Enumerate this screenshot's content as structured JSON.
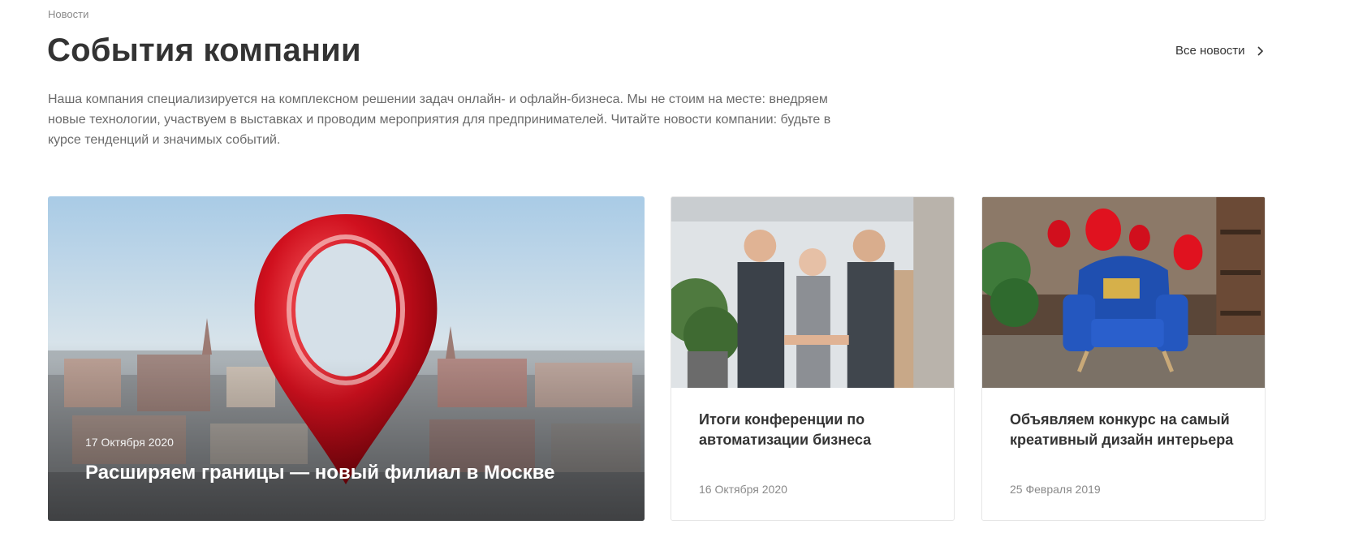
{
  "breadcrumb": "Новости",
  "page_title": "События компании",
  "all_news_label": "Все новости",
  "intro": "Наша компания специализируется на комплексном решении задач онлайн- и офлайн-бизнеса. Мы не стоим на месте: внедряем новые технологии, участвуем в выставках и проводим мероприятия для предпринимателей. Читайте новости компании: будьте в курсе тенденций и значимых событий.",
  "news": [
    {
      "date": "17 Октября 2020",
      "title": "Расширяем границы — новый филиал в Москве",
      "image": "red-map-pin-over-moscow-skyline"
    },
    {
      "date": "16 Октября 2020",
      "title": "Итоги конференции по автоматизации бизнеса",
      "image": "business-people-handshake-in-office"
    },
    {
      "date": "25 Февраля 2019",
      "title": "Объявляем конкурс на самый креативный дизайн интерьера",
      "image": "blue-armchair-with-red-balloons"
    }
  ],
  "colors": {
    "accent_red": "#c8101e",
    "title": "#333333",
    "muted": "#8a8a8a"
  }
}
